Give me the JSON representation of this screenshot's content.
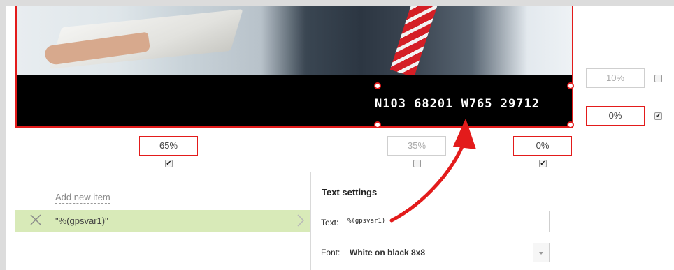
{
  "preview": {
    "overlay_text": "N103 68201 W765 29712"
  },
  "margins": {
    "top": {
      "value": "10%",
      "checked": false
    },
    "bottom": {
      "value": "0%",
      "checked": true
    },
    "left": {
      "value": "65%",
      "checked": true
    },
    "width": {
      "value": "35%",
      "checked": false
    },
    "right": {
      "value": "0%",
      "checked": true
    }
  },
  "items": {
    "add_label": "Add new item",
    "list": [
      {
        "label": "\"%(gpsvar1)\""
      }
    ]
  },
  "text_settings": {
    "title": "Text settings",
    "text_label": "Text:",
    "text_value": "%(gpsvar1)",
    "font_label": "Font:",
    "font_value": "White on black 8x8"
  },
  "colors": {
    "accent": "#e31b1b",
    "selected_item": "#d8eab8"
  },
  "icons": [
    "close-icon",
    "chevron-right-icon",
    "dropdown-arrow-icon",
    "checkbox-icon"
  ]
}
